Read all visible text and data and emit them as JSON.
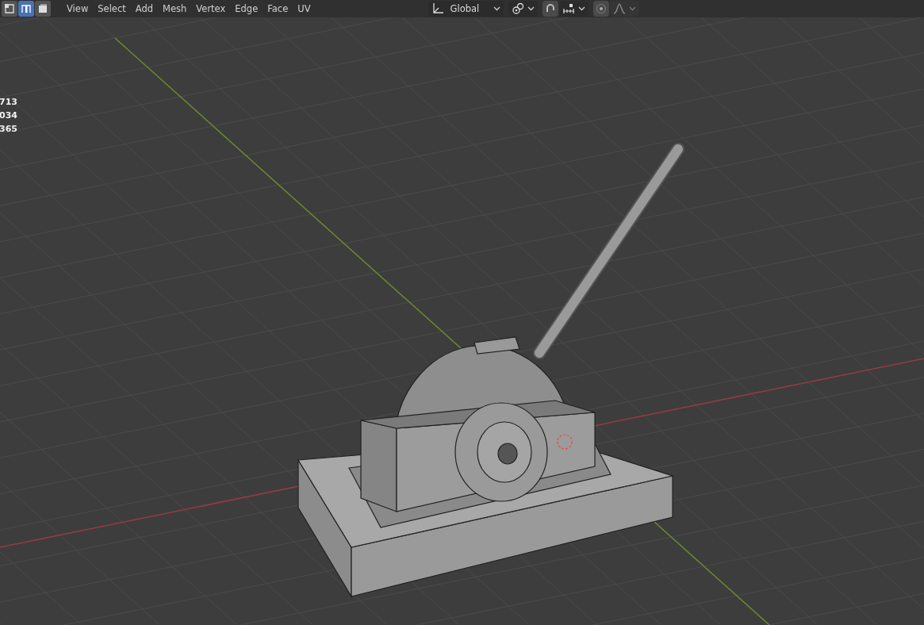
{
  "select_modes": [
    {
      "kind": "vertex",
      "selected": false
    },
    {
      "kind": "edge",
      "selected": true
    },
    {
      "kind": "face",
      "selected": false
    }
  ],
  "menu": [
    "View",
    "Select",
    "Add",
    "Mesh",
    "Vertex",
    "Edge",
    "Face",
    "UV"
  ],
  "orientation": {
    "value": "Global"
  },
  "snap": {
    "on": false
  },
  "proportional": {
    "on": false
  },
  "stats": [
    "713",
    "034",
    "365"
  ]
}
